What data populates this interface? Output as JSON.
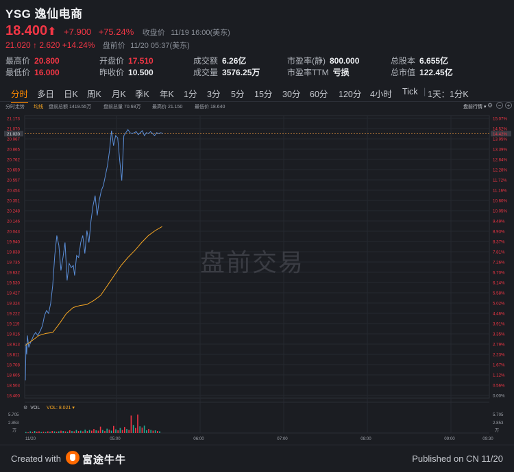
{
  "header": {
    "title": "YSG 逸仙电商",
    "price": "18.400",
    "change": "+7.900",
    "change_pct": "+75.24%",
    "close_label": "收盘价",
    "close_time": "11/19 16:00(美东)",
    "pre_price": "21.020",
    "pre_change": "2.620",
    "pre_change_pct": "+14.24%",
    "pre_label": "盘前价",
    "pre_time": "11/20 05:37(美东)"
  },
  "stats": {
    "high": {
      "label": "最高价",
      "value": "20.800"
    },
    "low": {
      "label": "最低价",
      "value": "16.000"
    },
    "open": {
      "label": "开盘价",
      "value": "17.510"
    },
    "prev_close": {
      "label": "昨收价",
      "value": "10.500"
    },
    "turnover": {
      "label": "成交额",
      "value": "6.26亿"
    },
    "volume": {
      "label": "成交量",
      "value": "3576.25万"
    },
    "pe_static": {
      "label": "市盈率(静)",
      "value": "800.000"
    },
    "pe_ttm": {
      "label": "市盈率TTM",
      "value": "亏损"
    },
    "total_shares": {
      "label": "总股本",
      "value": "6.655亿"
    },
    "market_cap": {
      "label": "总市值",
      "value": "122.45亿"
    }
  },
  "tabs": [
    "分时",
    "多日",
    "日K",
    "周K",
    "月K",
    "季K",
    "年K",
    "1分",
    "3分",
    "5分",
    "15分",
    "30分",
    "60分",
    "120分",
    "4小时",
    "Tick",
    "1天：1分K"
  ],
  "active_tab": "分时",
  "legend": {
    "timeshare": "分时走势",
    "avg": "均线",
    "pre_turnover": "盘前总额 1419.55万",
    "pre_volume": "盘前总量 70.68万",
    "pre_high": "最高价 21.150",
    "pre_low": "最低价 18.640",
    "panel": "盘前行情"
  },
  "watermark": "盘前交易",
  "volume_legend": {
    "vol": "VOL",
    "vol_value": "VOL: 8.021"
  },
  "footer": {
    "created": "Created with",
    "brand": "富途牛牛",
    "published": "Published on CN 11/20"
  },
  "colors": {
    "price_line": "#5b8fd9",
    "avg_line": "#f5a623",
    "up": "#f23645",
    "down": "#22ab94",
    "ref_line": "#d38a3a"
  },
  "chart_data": {
    "type": "line",
    "title": "",
    "x_ticks": [
      "11/20",
      "05:00",
      "06:00",
      "07:00",
      "08:00",
      "09:00",
      "09:30"
    ],
    "y_ticks_left": [
      "21.173",
      "21.070",
      "20.967",
      "20.865",
      "20.762",
      "20.659",
      "20.557",
      "20.454",
      "20.351",
      "20.248",
      "20.146",
      "20.043",
      "19.940",
      "19.838",
      "19.735",
      "19.632",
      "19.530",
      "19.427",
      "19.324",
      "19.222",
      "19.119",
      "19.016",
      "18.913",
      "18.811",
      "18.708",
      "18.605",
      "18.503",
      "18.400"
    ],
    "y_ticks_right": [
      "15.07%",
      "14.52%",
      "13.95%",
      "13.39%",
      "12.84%",
      "12.28%",
      "11.72%",
      "11.16%",
      "10.60%",
      "10.05%",
      "9.49%",
      "8.93%",
      "8.37%",
      "7.81%",
      "7.26%",
      "6.70%",
      "6.14%",
      "5.58%",
      "5.02%",
      "4.46%",
      "3.91%",
      "3.35%",
      "2.79%",
      "2.23%",
      "1.67%",
      "1.12%",
      "0.56%",
      "0.00%"
    ],
    "ylim": [
      18.4,
      21.173
    ],
    "current_price": "21.020",
    "current_pct": "14.42%",
    "series": [
      {
        "name": "分时",
        "x": [
          0,
          1,
          2,
          3,
          5,
          7,
          9,
          12,
          15,
          18,
          22,
          25,
          28,
          31,
          34,
          37,
          40,
          43,
          46,
          49,
          52,
          55,
          58,
          61,
          64,
          67,
          70,
          72,
          75,
          78,
          81,
          84,
          87,
          90,
          93,
          96,
          99,
          102,
          105,
          108,
          111,
          114,
          117,
          120,
          123,
          126,
          129,
          132,
          135,
          138,
          141,
          144,
          147,
          150,
          153,
          156,
          159,
          162,
          165,
          168,
          171,
          174,
          177,
          180,
          183,
          186,
          189,
          192,
          195,
          198,
          201
        ],
        "values": [
          18.55,
          18.92,
          18.81,
          19.0,
          18.88,
          18.92,
          18.95,
          19.0,
          19.03,
          19.0,
          19.05,
          19.1,
          19.2,
          19.25,
          19.22,
          19.32,
          19.5,
          19.8,
          20.0,
          19.9,
          19.65,
          19.78,
          19.93,
          19.55,
          19.72,
          19.68,
          19.7,
          19.6,
          19.8,
          19.78,
          19.93,
          20.0,
          19.82,
          20.05,
          19.93,
          20.15,
          20.3,
          20.4,
          20.2,
          20.35,
          20.45,
          20.5,
          20.6,
          20.7,
          20.85,
          21.05,
          20.9,
          21.0,
          20.98,
          20.75,
          20.55,
          21.0,
          21.03,
          21.06,
          21.03,
          21.02,
          21.03,
          21.04,
          21.01,
          21.03,
          21.05,
          21.0,
          21.03,
          21.02,
          21.04,
          21.02,
          21.0,
          21.03,
          21.02,
          21.03,
          21.02
        ]
      },
      {
        "name": "均线",
        "x": [
          0,
          10,
          20,
          30,
          40,
          50,
          60,
          70,
          80,
          90,
          100,
          110,
          120,
          130,
          140,
          150,
          160,
          170,
          180,
          190,
          200
        ],
        "values": [
          18.9,
          18.95,
          19.0,
          19.02,
          19.03,
          19.12,
          19.22,
          19.28,
          19.3,
          19.31,
          19.35,
          19.4,
          19.5,
          19.6,
          19.7,
          19.78,
          19.85,
          19.93,
          20.0,
          20.05,
          20.09
        ]
      }
    ],
    "volume": {
      "ylabel": "万",
      "ylim": [
        0,
        5.705
      ],
      "y_ticks": [
        "5.705",
        "2.853"
      ],
      "bars": [
        0.3,
        0.2,
        0.5,
        0.3,
        0.6,
        0.4,
        0.5,
        0.3,
        0.4,
        0.3,
        0.5,
        0.4,
        0.6,
        0.5,
        0.4,
        0.5,
        0.7,
        0.6,
        0.5,
        0.4,
        0.8,
        0.6,
        0.5,
        0.9,
        0.6,
        0.7,
        0.5,
        1.0,
        0.6,
        0.9,
        0.7,
        1.2,
        0.8,
        0.7,
        1.9,
        0.9,
        0.6,
        1.3,
        1.0,
        0.7,
        2.1,
        1.1,
        0.8,
        1.5,
        0.9,
        1.8,
        1.2,
        0.9,
        5.2,
        2.4,
        1.5,
        5.5,
        2.0,
        1.6,
        2.2,
        0.8,
        1.2,
        0.9,
        0.7,
        0.8,
        0.6,
        0.5
      ],
      "bar_colors": [
        "down",
        "up",
        "down",
        "up",
        "down",
        "up",
        "up",
        "down",
        "up",
        "down",
        "up",
        "down",
        "up",
        "down",
        "up",
        "down",
        "up",
        "down",
        "up",
        "down",
        "up",
        "down",
        "up",
        "down",
        "up",
        "down",
        "up",
        "down",
        "up",
        "down",
        "up",
        "up",
        "down",
        "up",
        "up",
        "down",
        "up",
        "down",
        "up",
        "down",
        "up",
        "down",
        "up",
        "down",
        "up",
        "up",
        "down",
        "up",
        "up",
        "down",
        "up",
        "up",
        "down",
        "up",
        "down",
        "down",
        "up",
        "down",
        "up",
        "down",
        "up",
        "down"
      ]
    }
  }
}
